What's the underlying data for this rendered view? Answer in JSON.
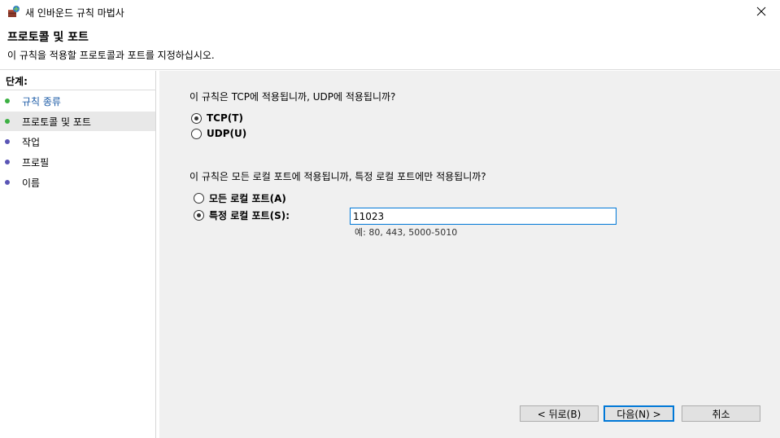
{
  "window": {
    "title": "새 인바운드 규칙 마법사",
    "icon": "firewall-rule-icon"
  },
  "header": {
    "title": "프로토콜 및 포트",
    "subtitle": "이 규칙을 적용할 프로토콜과 포트를 지정하십시오."
  },
  "sidebar": {
    "heading": "단계:",
    "steps": [
      {
        "label": "규칙 종류",
        "dot_color": "#3cb043",
        "link": true
      },
      {
        "label": "프로토콜 및 포트",
        "dot_color": "#3cb043",
        "link": false,
        "active": true
      },
      {
        "label": "작업",
        "dot_color": "#5a55b5",
        "link": false
      },
      {
        "label": "프로필",
        "dot_color": "#5a55b5",
        "link": false
      },
      {
        "label": "이름",
        "dot_color": "#5a55b5",
        "link": false
      }
    ]
  },
  "protocol": {
    "question": "이 규칙은 TCP에 적용됩니까, UDP에 적용됩니까?",
    "options": [
      {
        "label": "TCP(T)",
        "checked": true
      },
      {
        "label": "UDP(U)",
        "checked": false
      }
    ]
  },
  "ports": {
    "question": "이 규칙은 모든 로컬 포트에 적용됩니까, 특정 로컬 포트에만 적용됩니까?",
    "options": [
      {
        "label": "모든 로컬 포트(A)",
        "checked": false
      },
      {
        "label": "특정 로컬 포트(S):",
        "checked": true
      }
    ],
    "input_value": "11023",
    "hint": "예: 80, 443, 5000-5010"
  },
  "buttons": {
    "back": "< 뒤로(B)",
    "next": "다음(N) >",
    "cancel": "취소"
  },
  "colors": {
    "accent": "#0078d7",
    "content_bg": "#f0f0f0",
    "link": "#1a5aa6"
  }
}
